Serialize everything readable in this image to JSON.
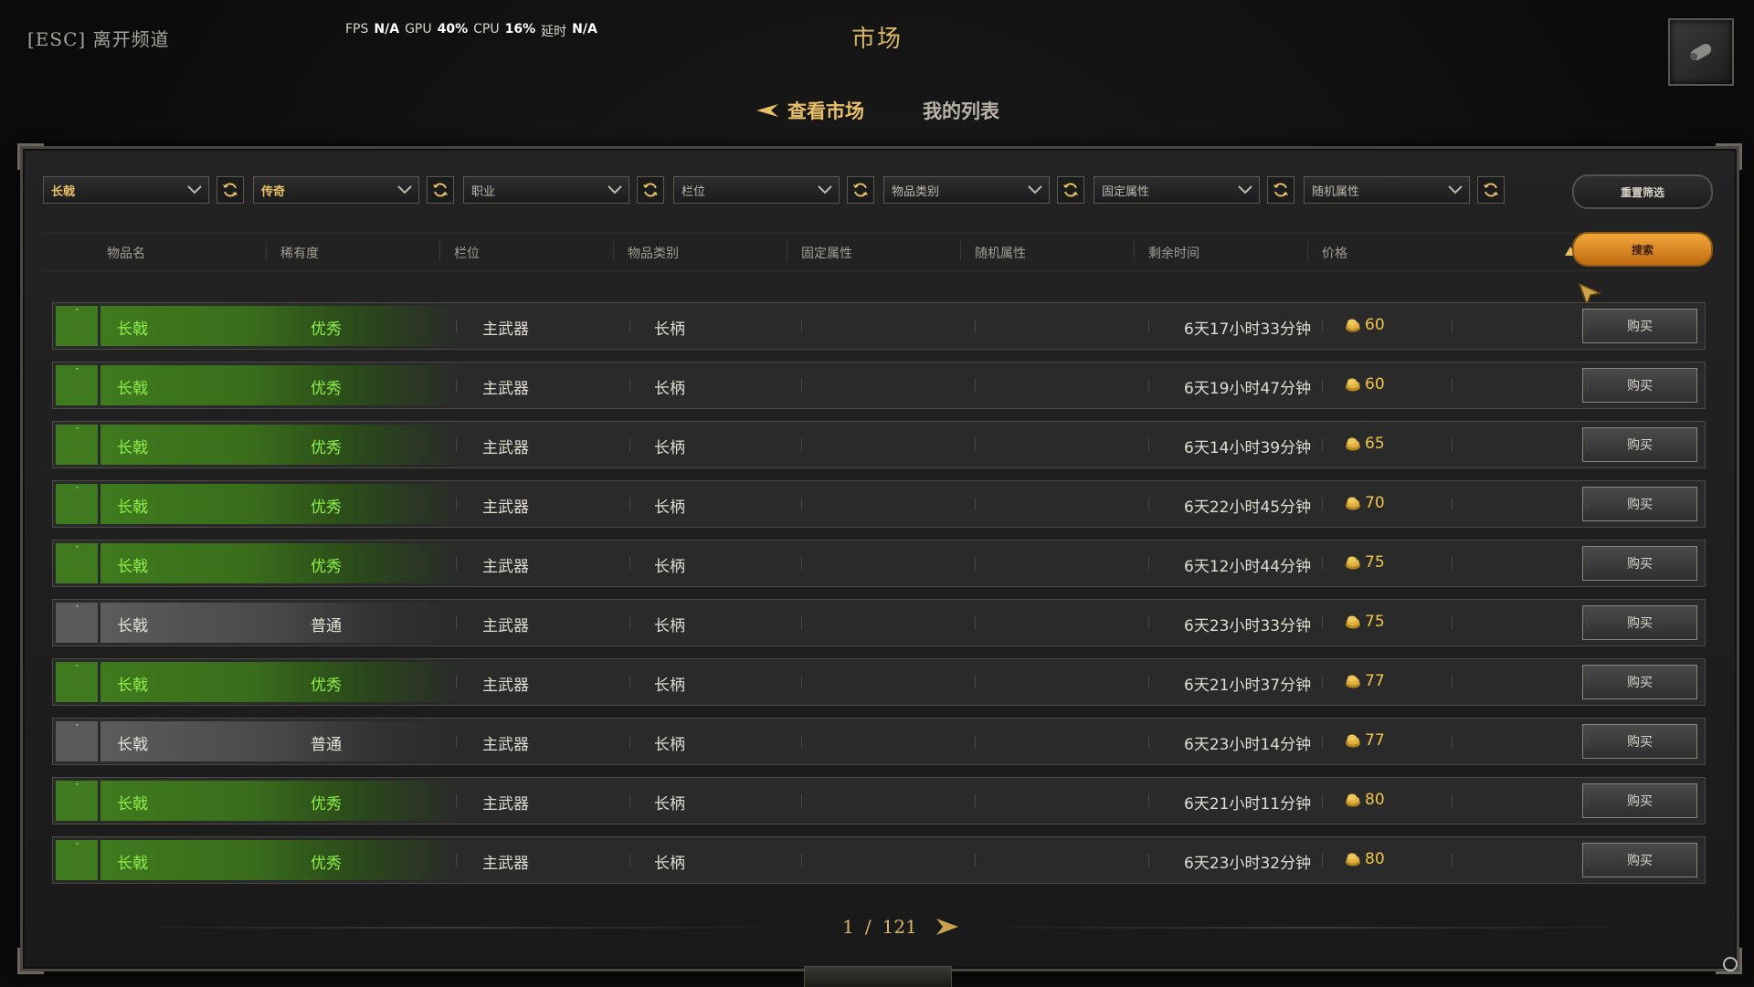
{
  "top_bar": {
    "esc_label": "[ESC] 离开频道",
    "perf": {
      "fps_label": "FPS",
      "fps_value": "N/A",
      "gpu_label": "GPU",
      "gpu_value": "40%",
      "cpu_label": "CPU",
      "cpu_value": "16%",
      "latency_label": "延时",
      "latency_value": "N/A"
    },
    "title": "市场"
  },
  "tabs": [
    {
      "label": "查看市场",
      "active": true
    },
    {
      "label": "我的列表",
      "active": false
    }
  ],
  "filters": [
    {
      "value": "长戟",
      "set": true
    },
    {
      "value": "传奇",
      "set": true
    },
    {
      "value": "职业",
      "set": false
    },
    {
      "value": "栏位",
      "set": false
    },
    {
      "value": "物品类别",
      "set": false
    },
    {
      "value": "固定属性",
      "set": false
    },
    {
      "value": "随机属性",
      "set": false
    }
  ],
  "reset_label": "重置筛选",
  "search_label": "搜索",
  "columns": [
    "物品名",
    "稀有度",
    "栏位",
    "物品类别",
    "固定属性",
    "随机属性",
    "剩余时间",
    "价格"
  ],
  "buy_label": "购买",
  "rows": [
    {
      "name": "长戟",
      "rarity": "优秀",
      "tier": "excellent",
      "slot": "主武器",
      "type": "长柄",
      "time": "6天17小时33分钟",
      "price": "60"
    },
    {
      "name": "长戟",
      "rarity": "优秀",
      "tier": "excellent",
      "slot": "主武器",
      "type": "长柄",
      "time": "6天19小时47分钟",
      "price": "60"
    },
    {
      "name": "长戟",
      "rarity": "优秀",
      "tier": "excellent",
      "slot": "主武器",
      "type": "长柄",
      "time": "6天14小时39分钟",
      "price": "65"
    },
    {
      "name": "长戟",
      "rarity": "优秀",
      "tier": "excellent",
      "slot": "主武器",
      "type": "长柄",
      "time": "6天22小时45分钟",
      "price": "70"
    },
    {
      "name": "长戟",
      "rarity": "优秀",
      "tier": "excellent",
      "slot": "主武器",
      "type": "长柄",
      "time": "6天12小时44分钟",
      "price": "75"
    },
    {
      "name": "长戟",
      "rarity": "普通",
      "tier": "common",
      "slot": "主武器",
      "type": "长柄",
      "time": "6天23小时33分钟",
      "price": "75"
    },
    {
      "name": "长戟",
      "rarity": "优秀",
      "tier": "excellent",
      "slot": "主武器",
      "type": "长柄",
      "time": "6天21小时37分钟",
      "price": "77"
    },
    {
      "name": "长戟",
      "rarity": "普通",
      "tier": "common",
      "slot": "主武器",
      "type": "长柄",
      "time": "6天23小时14分钟",
      "price": "77"
    },
    {
      "name": "长戟",
      "rarity": "优秀",
      "tier": "excellent",
      "slot": "主武器",
      "type": "长柄",
      "time": "6天21小时11分钟",
      "price": "80"
    },
    {
      "name": "长戟",
      "rarity": "优秀",
      "tier": "excellent",
      "slot": "主武器",
      "type": "长柄",
      "time": "6天23小时32分钟",
      "price": "80"
    }
  ],
  "pagination": {
    "current": "1",
    "separator": "/",
    "total": "121"
  },
  "colors": {
    "gold": "#e8c067",
    "excellent": "#8ef04a",
    "search_orange": "#e08a22"
  }
}
